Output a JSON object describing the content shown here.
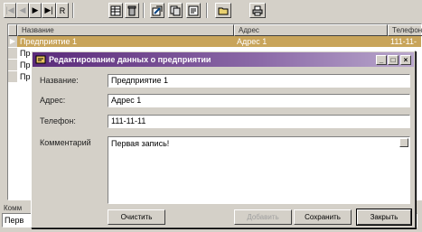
{
  "toolbar": {
    "first": "|◀",
    "prev": "◀",
    "next": "▶",
    "last": "▶|",
    "refresh": "R",
    "icons": [
      "table-icon",
      "trash-icon",
      "edit-record-icon",
      "copy-record-icon",
      "filter-icon",
      "folder-icon",
      "print-icon"
    ]
  },
  "grid": {
    "columns": [
      "Название",
      "Адрес",
      "Телефон"
    ],
    "rows": [
      {
        "indicator": "▶",
        "name": "Предприятие 1",
        "address": "Адрес 1",
        "phone": "111-11-"
      },
      {
        "indicator": "",
        "name": "Пре",
        "address": "",
        "phone": ""
      },
      {
        "indicator": "",
        "name": "Пр",
        "address": "",
        "phone": ""
      },
      {
        "indicator": "",
        "name": "Пр",
        "address": "",
        "phone": ""
      }
    ]
  },
  "bottom": {
    "label": "Комм",
    "value": "Перв"
  },
  "dialog": {
    "title": "Редактирование данных о предприятии",
    "fields": {
      "name_label": "Название:",
      "name_value": "Предприятие 1",
      "address_label": "Адрес:",
      "address_value": "Адрес 1",
      "phone_label": "Телефон:",
      "phone_value": "111-11-11",
      "comment_label": "Комментарий",
      "comment_value": "Первая запись!"
    },
    "buttons": {
      "clear": "Очистить",
      "add": "Добавить",
      "save": "Сохранить",
      "close": "Закрыть"
    },
    "caption_buttons": {
      "minimize": "_",
      "maximize": "□",
      "close": "×"
    }
  },
  "colors": {
    "selection": "#c8a45a",
    "title_start": "#5a2a7a",
    "title_end": "#b9a7cc",
    "face": "#d4d0c8"
  }
}
